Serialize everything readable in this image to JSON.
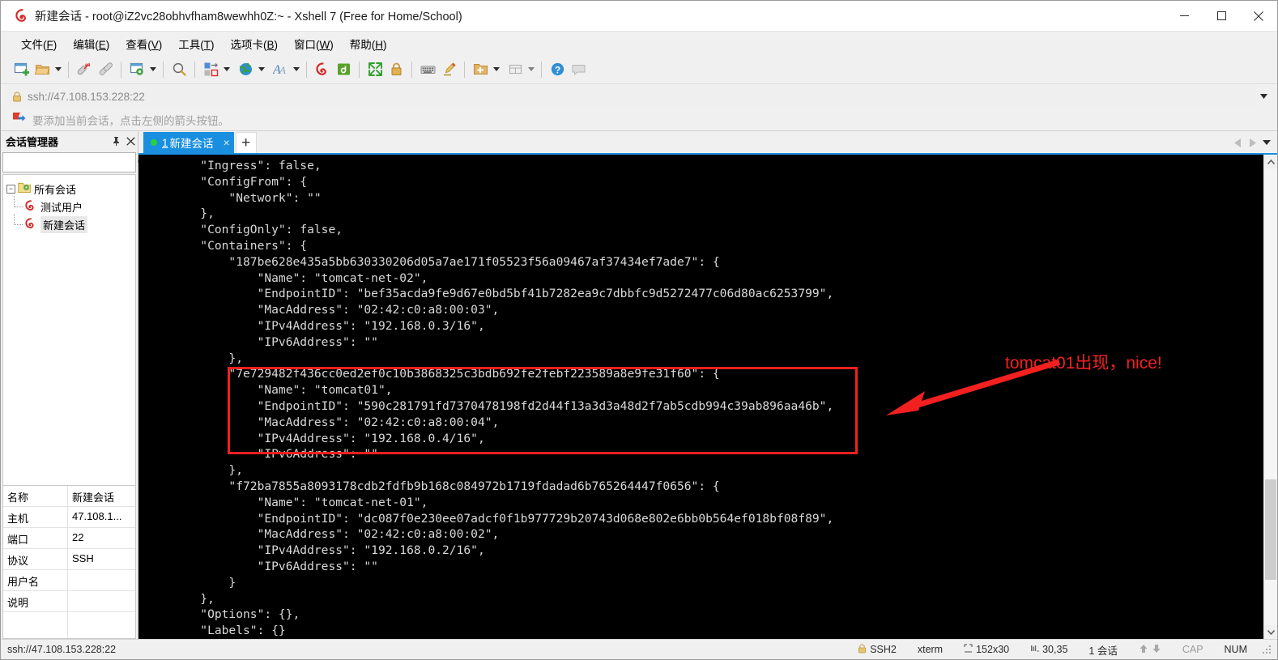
{
  "window": {
    "title": "新建会话 - root@iZ2vc28obhvfham8wewhh0Z:~ - Xshell 7 (Free for Home/School)",
    "app_icon": "xshell-logo-icon",
    "minimize_label": "最小化",
    "maximize_label": "最大化",
    "close_label": "关闭"
  },
  "menubar": {
    "items": [
      {
        "name": "file",
        "text": "文件",
        "accel": "F"
      },
      {
        "name": "edit",
        "text": "编辑",
        "accel": "E"
      },
      {
        "name": "view",
        "text": "查看",
        "accel": "V"
      },
      {
        "name": "tools",
        "text": "工具",
        "accel": "T"
      },
      {
        "name": "tabs",
        "text": "选项卡",
        "accel": "B"
      },
      {
        "name": "window",
        "text": "窗口",
        "accel": "W"
      },
      {
        "name": "help",
        "text": "帮助",
        "accel": "H"
      }
    ]
  },
  "toolbar": {
    "buttons": [
      {
        "name": "new-session-icon",
        "title": "新建会话"
      },
      {
        "name": "open-folder-icon",
        "title": "打开",
        "caret": true
      },
      {
        "sep": true
      },
      {
        "name": "disconnect-icon",
        "title": "断开"
      },
      {
        "name": "reconnect-icon",
        "title": "重新连接"
      },
      {
        "sep": true
      },
      {
        "name": "session-properties-icon",
        "title": "属性",
        "caret": true
      },
      {
        "sep": true
      },
      {
        "name": "find-icon",
        "title": "查找"
      },
      {
        "sep": true
      },
      {
        "name": "transfer-icon",
        "title": "传输",
        "caret": true
      },
      {
        "name": "globe-icon",
        "title": "浏览器",
        "caret": true
      },
      {
        "name": "font-icon",
        "title": "字体",
        "caret": true
      },
      {
        "sep": true
      },
      {
        "name": "xshell-icon",
        "title": "Xshell"
      },
      {
        "name": "xftp-icon",
        "title": "Xftp"
      },
      {
        "sep": true
      },
      {
        "name": "fullscreen-icon",
        "title": "全屏"
      },
      {
        "name": "lock-icon",
        "title": "锁定"
      },
      {
        "sep": true
      },
      {
        "name": "keyboard-icon",
        "title": "键盘"
      },
      {
        "name": "highlight-icon",
        "title": "高亮"
      },
      {
        "sep": true
      },
      {
        "name": "new-folder-icon",
        "title": "新建文件夹",
        "caret": true
      },
      {
        "name": "layout-icon",
        "title": "布局",
        "caret": true
      },
      {
        "sep": true
      },
      {
        "name": "help-icon",
        "title": "帮助"
      },
      {
        "name": "feedback-icon",
        "title": "反馈"
      }
    ]
  },
  "address_bar": {
    "value": "ssh://47.108.153.228:22",
    "placeholder": "ssh://host:port",
    "lock_icon": "lock-icon",
    "dropdown_icon": "chevron-down-icon"
  },
  "hint_bar": {
    "icon": "bookmark-arrow-icon",
    "text": "要添加当前会话，点击左侧的箭头按钮。"
  },
  "session_manager": {
    "title": "会话管理器",
    "pin_label": "固定",
    "close_label": "关闭",
    "search_value": "",
    "search_placeholder": "",
    "search_icon": "search-icon",
    "tree": {
      "root": {
        "label": "所有会话",
        "icon": "folder-sessions-icon",
        "expanded": true
      },
      "children": [
        {
          "label": "测试用户",
          "icon": "xshell-session-icon",
          "selected": false
        },
        {
          "label": "新建会话",
          "icon": "xshell-session-icon",
          "selected": true
        }
      ]
    },
    "properties": [
      {
        "key": "名称",
        "value": "新建会话"
      },
      {
        "key": "主机",
        "value": "47.108.1..."
      },
      {
        "key": "端口",
        "value": "22"
      },
      {
        "key": "协议",
        "value": "SSH"
      },
      {
        "key": "用户名",
        "value": ""
      },
      {
        "key": "说明",
        "value": ""
      }
    ]
  },
  "tabs": {
    "items": [
      {
        "number": "1",
        "label": "新建会话",
        "active": true,
        "status_color": "#29d13a",
        "close_label": "×"
      }
    ],
    "new_tab_label": "+",
    "scroll_left_icon": "chevron-left-icon",
    "scroll_right_icon": "chevron-right-icon",
    "tab_menu_icon": "chevron-down-icon"
  },
  "terminal": {
    "lines": [
      "        \"Ingress\": false,",
      "        \"ConfigFrom\": {",
      "            \"Network\": \"\"",
      "        },",
      "        \"ConfigOnly\": false,",
      "        \"Containers\": {",
      "            \"187be628e435a5bb630330206d05a7ae171f05523f56a09467af37434ef7ade7\": {",
      "                \"Name\": \"tomcat-net-02\",",
      "                \"EndpointID\": \"bef35acda9fe9d67e0bd5bf41b7282ea9c7dbbfc9d5272477c06d80ac6253799\",",
      "                \"MacAddress\": \"02:42:c0:a8:00:03\",",
      "                \"IPv4Address\": \"192.168.0.3/16\",",
      "                \"IPv6Address\": \"\"",
      "            },",
      "            \"7e729482f436cc0ed2ef0c10b3868325c3bdb692fe2febf223589a8e9fe31f60\": {",
      "                \"Name\": \"tomcat01\",",
      "                \"EndpointID\": \"590c281791fd7370478198fd2d44f13a3d3a48d2f7ab5cdb994c39ab896aa46b\",",
      "                \"MacAddress\": \"02:42:c0:a8:00:04\",",
      "                \"IPv4Address\": \"192.168.0.4/16\",",
      "                \"IPv6Address\": \"\"",
      "            },",
      "            \"f72ba7855a8093178cdb2fdfb9b168c084972b1719fdadad6b765264447f0656\": {",
      "                \"Name\": \"tomcat-net-01\",",
      "                \"EndpointID\": \"dc087f0e230ee07adcf0f1b977729b20743d068e802e6bb0b564ef018bf08f89\",",
      "                \"MacAddress\": \"02:42:c0:a8:00:02\",",
      "                \"IPv4Address\": \"192.168.0.2/16\",",
      "                \"IPv6Address\": \"\"",
      "            }",
      "        },",
      "        \"Options\": {},",
      "        \"Labels\": {}"
    ]
  },
  "annotation": {
    "text": "tomcat01出现，nice!",
    "color": "#f32020",
    "highlight_box_label": "tomcat01-highlight-box",
    "arrow_label": "annotation-arrow"
  },
  "scrollbar": {
    "up_icon": "chevron-up-icon",
    "down_icon": "chevron-down-icon"
  },
  "statusbar": {
    "url": "ssh://47.108.153.228:22",
    "security": "SSH2",
    "security_icon": "lock-icon",
    "term_type": "xterm",
    "size": "152x30",
    "size_icon": "screen-size-icon",
    "cursor": "30,35",
    "cursor_icon": "cursor-pos-icon",
    "sessions": "1 会话",
    "upload_icon": "arrow-up-icon",
    "download_icon": "arrow-down-icon",
    "caps": "CAP",
    "num": "NUM"
  }
}
